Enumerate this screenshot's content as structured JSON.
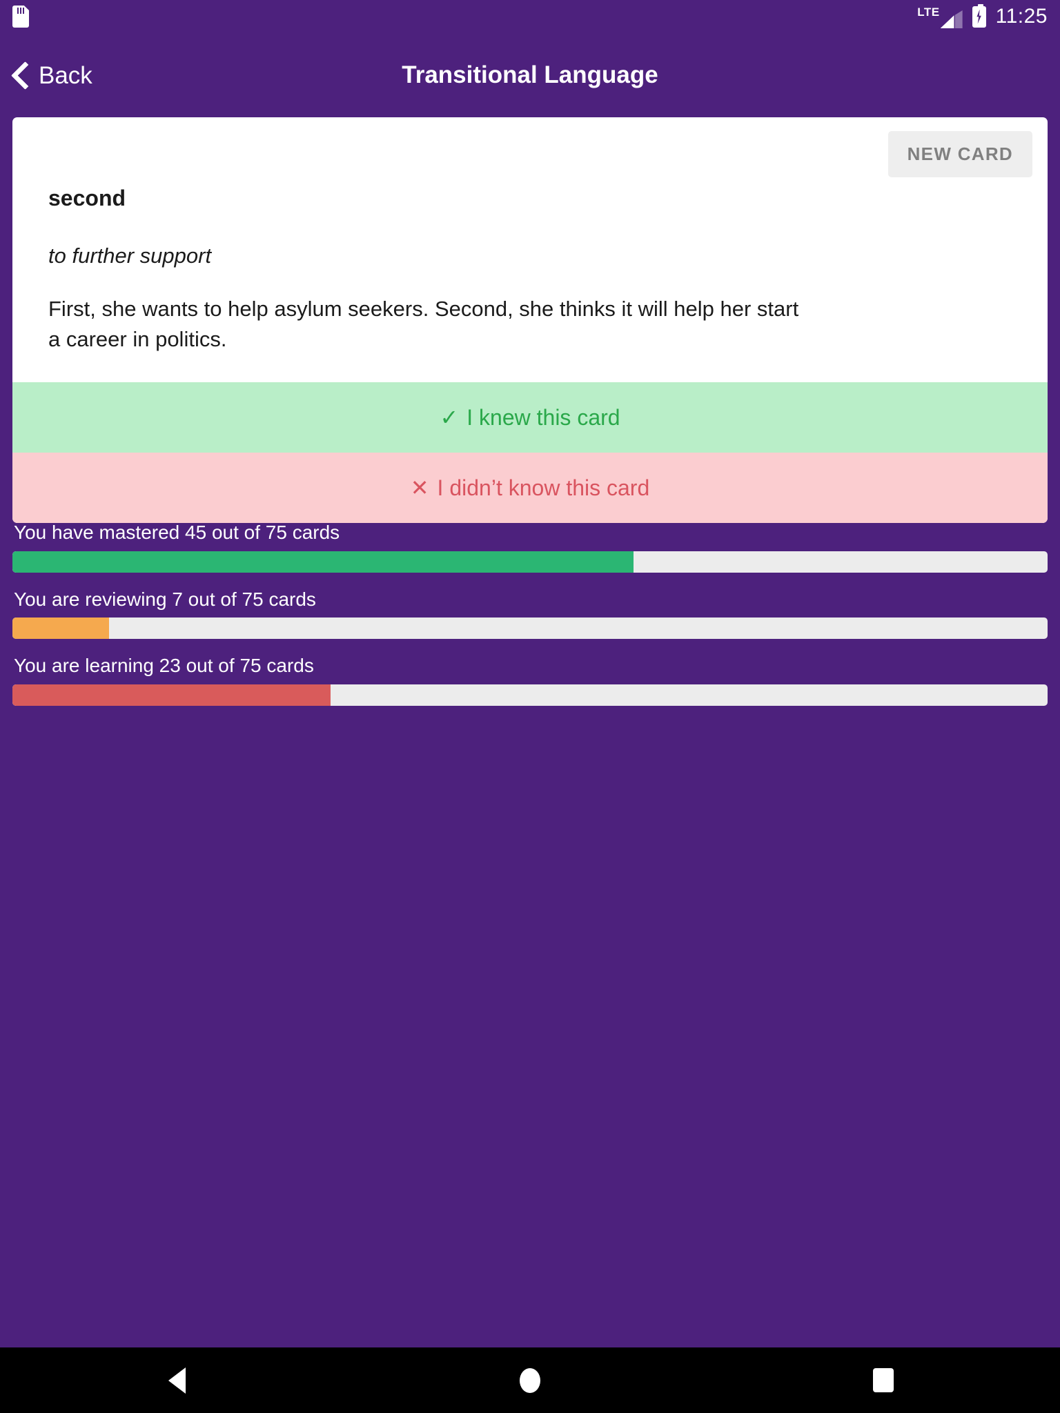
{
  "status_bar": {
    "sd_card_icon": "sd-card-icon",
    "network_label": "LTE",
    "signal_icon": "signal-bars-icon",
    "battery_icon": "battery-charging-icon",
    "time": "11:25"
  },
  "header": {
    "back_icon": "chevron-left-icon",
    "back_label": "Back",
    "title": "Transitional Language"
  },
  "card": {
    "new_card_label": "NEW CARD",
    "term": "second",
    "definition": "to further support",
    "example": "First, she wants to help asylum seekers. Second, she thinks it will help her start a career in politics.",
    "known": {
      "mark": "✓",
      "label": "I knew this card",
      "bg_color": "#b9eec8",
      "text_color": "#2aa84a"
    },
    "unknown": {
      "mark": "✕",
      "label": "I didn’t know this card",
      "bg_color": "#fbcdd0",
      "text_color": "#d9545f"
    }
  },
  "progress": {
    "total_cards": 75,
    "items": [
      {
        "label": "You have mastered 45 out of 75 cards",
        "count": 45,
        "percent": 60,
        "color": "#2bb673"
      },
      {
        "label": "You are reviewing 7 out of 75 cards",
        "count": 7,
        "percent": 9.3,
        "color": "#f5a94e"
      },
      {
        "label": "You are learning 23 out of 75 cards",
        "count": 23,
        "percent": 30.7,
        "color": "#d95b5b"
      }
    ]
  },
  "nav_bar": {
    "back_icon": "triangle-back-icon",
    "home_icon": "circle-home-icon",
    "recents_icon": "square-recents-icon"
  },
  "theme": {
    "purple": "#4d217d",
    "card_bg": "#ffffff",
    "track_bg": "#ececec"
  }
}
